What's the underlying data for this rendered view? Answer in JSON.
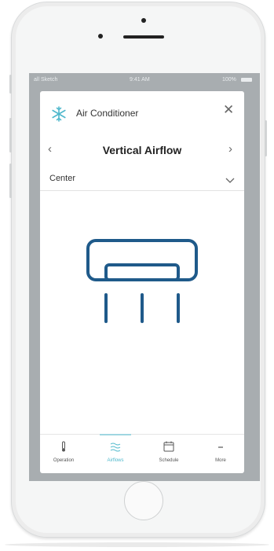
{
  "status_bar": {
    "carrier": "all Sketch",
    "time": "9:41 AM",
    "battery": "100%"
  },
  "header": {
    "app_title": "Air Conditioner",
    "close_icon": "close-icon",
    "brand_icon": "snowflake-icon"
  },
  "airflow_nav": {
    "title": "Vertical Airflow",
    "prev_icon": "chevron-left-icon",
    "next_icon": "chevron-right-icon"
  },
  "direction_select": {
    "value": "Center",
    "icon": "chevron-down-icon"
  },
  "illustration": {
    "icon": "air-conditioner-airflow-icon"
  },
  "tabs": [
    {
      "label": "Operation",
      "icon": "thermometer-icon",
      "active": false
    },
    {
      "label": "Airflows",
      "icon": "airflow-icon",
      "active": true
    },
    {
      "label": "Schedule",
      "icon": "calendar-icon",
      "active": false
    },
    {
      "label": "More",
      "icon": "more-icon",
      "active": false
    }
  ],
  "colors": {
    "accent": "#4fb8cc",
    "illustration": "#1f5a8a",
    "screen_bg": "#a8adb0"
  }
}
